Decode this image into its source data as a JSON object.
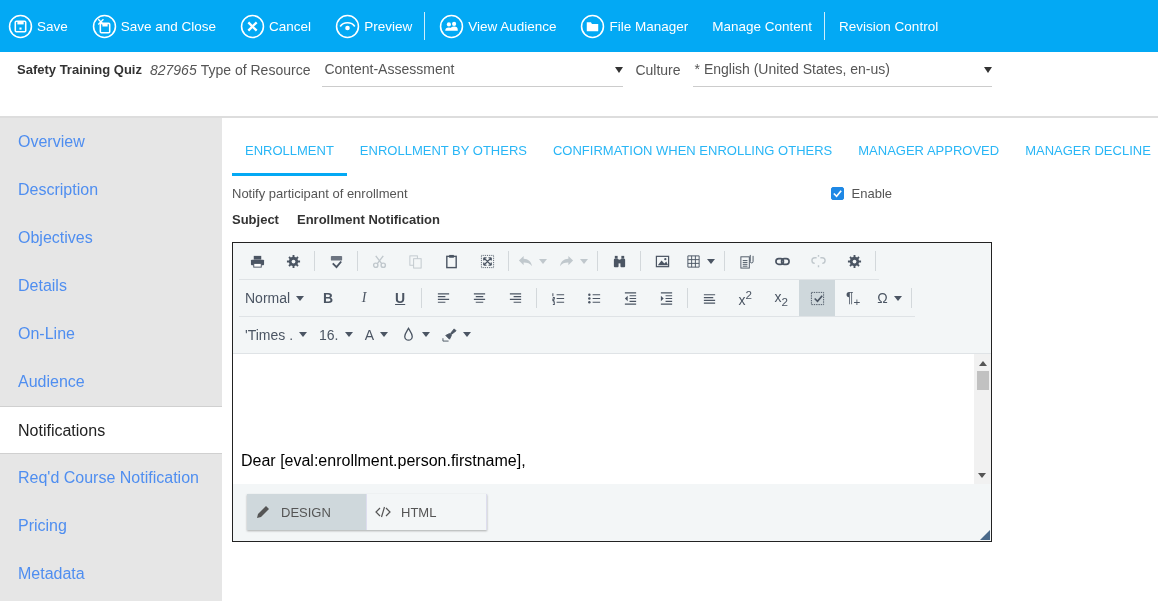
{
  "toolbar": [
    {
      "kind": "icon-button",
      "label": "Save"
    },
    {
      "kind": "icon-button",
      "label": "Save and Close"
    },
    {
      "kind": "icon-button",
      "label": "Cancel"
    },
    {
      "kind": "icon-button",
      "label": "Preview"
    },
    {
      "kind": "separator"
    },
    {
      "kind": "icon-button",
      "label": "View Audience"
    },
    {
      "kind": "icon-button",
      "label": "File Manager"
    },
    {
      "kind": "button",
      "label": "Manage Content"
    },
    {
      "kind": "separator"
    },
    {
      "kind": "button",
      "label": "Revision Control"
    }
  ],
  "header": {
    "title": "Safety Training Quiz",
    "id": "827965",
    "resource_label": "Type of Resource",
    "resource_value": "Content-Assessment",
    "culture_label": "Culture",
    "culture_value": "* English (United States, en-us)"
  },
  "sidebar": {
    "items": [
      {
        "label": "Overview",
        "selected": false
      },
      {
        "label": "Description",
        "selected": false
      },
      {
        "label": "Objectives",
        "selected": false
      },
      {
        "label": "Details",
        "selected": false
      },
      {
        "label": "On-Line",
        "selected": false
      },
      {
        "label": "Audience",
        "selected": false
      },
      {
        "label": "Notifications",
        "selected": true
      },
      {
        "label": "Req'd Course Notification",
        "selected": false
      },
      {
        "label": "Pricing",
        "selected": false
      },
      {
        "label": "Metadata",
        "selected": false
      }
    ]
  },
  "tabs": [
    {
      "label": "ENROLLMENT",
      "selected": true
    },
    {
      "label": "ENROLLMENT BY OTHERS",
      "selected": false
    },
    {
      "label": "CONFIRMATION WHEN ENROLLING OTHERS",
      "selected": false
    },
    {
      "label": "MANAGER APPROVED",
      "selected": false
    },
    {
      "label": "MANAGER DECLINE",
      "selected": false
    }
  ],
  "notify": {
    "label": "Notify participant of enrollment",
    "enable_label": "Enable",
    "checked": true
  },
  "subject": {
    "label": "Subject",
    "value": "Enrollment Notification"
  },
  "editor": {
    "toolbar_rows": [
      [
        {
          "kind": "icon",
          "disabled": false
        },
        {
          "kind": "icon",
          "disabled": false
        },
        {
          "kind": "separator"
        },
        {
          "kind": "icon",
          "disabled": false
        },
        {
          "kind": "separator"
        },
        {
          "kind": "icon",
          "disabled": true
        },
        {
          "kind": "icon",
          "disabled": true
        },
        {
          "kind": "icon",
          "disabled": false
        },
        {
          "kind": "icon",
          "disabled": false
        },
        {
          "kind": "separator"
        },
        {
          "kind": "icon-dropdown",
          "disabled": true
        },
        {
          "kind": "icon-dropdown",
          "disabled": true
        },
        {
          "kind": "separator"
        },
        {
          "kind": "icon",
          "disabled": false
        },
        {
          "kind": "separator"
        },
        {
          "kind": "icon",
          "disabled": false
        },
        {
          "kind": "icon-dropdown",
          "disabled": false
        },
        {
          "kind": "separator"
        },
        {
          "kind": "icon",
          "disabled": false
        },
        {
          "kind": "icon",
          "disabled": false
        },
        {
          "kind": "icon",
          "disabled": true
        },
        {
          "kind": "icon",
          "disabled": false
        },
        {
          "kind": "separator"
        }
      ],
      [
        {
          "kind": "text-dropdown",
          "label": "Normal",
          "disabled": false
        },
        {
          "kind": "text",
          "label": "B",
          "disabled": false
        },
        {
          "kind": "text",
          "label": "I",
          "disabled": false
        },
        {
          "kind": "text",
          "label": "U",
          "disabled": false
        },
        {
          "kind": "separator"
        },
        {
          "kind": "icon",
          "disabled": false
        },
        {
          "kind": "icon",
          "disabled": false
        },
        {
          "kind": "icon",
          "disabled": false
        },
        {
          "kind": "separator"
        },
        {
          "kind": "icon",
          "disabled": false
        },
        {
          "kind": "icon",
          "disabled": false
        },
        {
          "kind": "icon",
          "disabled": false
        },
        {
          "kind": "icon",
          "disabled": false
        },
        {
          "kind": "separator"
        },
        {
          "kind": "icon",
          "disabled": false
        },
        {
          "kind": "text",
          "label": "x$^{2}$",
          "disabled": false
        },
        {
          "kind": "text",
          "label": "x$_{2}$",
          "disabled": false
        },
        {
          "kind": "icon",
          "disabled": false,
          "selected": true
        },
        {
          "kind": "text",
          "label": "¶$_{+}$",
          "disabled": false
        },
        {
          "kind": "text-dropdown",
          "label": "Ω",
          "disabled": false
        },
        {
          "kind": "separator"
        }
      ],
      [
        {
          "kind": "text-dropdown",
          "label": "'Times .",
          "disabled": false
        },
        {
          "kind": "text-dropdown",
          "label": "16.",
          "disabled": false
        },
        {
          "kind": "text-dropdown",
          "label": "A",
          "disabled": false
        },
        {
          "kind": "icon-dropdown",
          "disabled": false
        },
        {
          "kind": "icon-dropdown",
          "disabled": false
        }
      ]
    ],
    "content": "Dear [eval:enrollment.person.firstname],",
    "modes": [
      {
        "label": "DESIGN",
        "selected": true
      },
      {
        "label": "HTML",
        "selected": false
      }
    ]
  }
}
